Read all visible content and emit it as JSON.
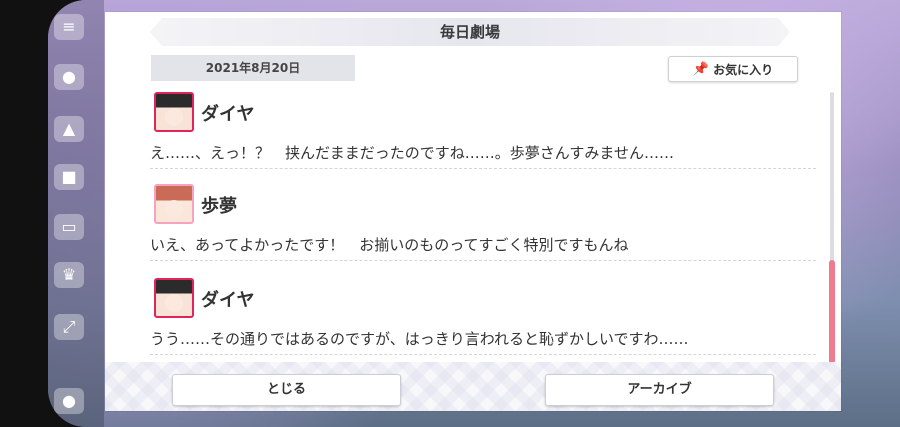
{
  "modal": {
    "title": "毎日劇場",
    "date": "2021年8月20日",
    "favorite_label": "お気に入り"
  },
  "messages": [
    {
      "speaker": "ダイヤ",
      "text": "え……、えっ！？　挟んだままだったのですね……。歩夢さんすみません……"
    },
    {
      "speaker": "歩夢",
      "text": "いえ、あってよかったです！　お揃いのものってすごく特別ですもんね"
    },
    {
      "speaker": "ダイヤ",
      "text": "うう……その通りではあるのですが、はっきり言われると恥ずかしいですわ……"
    }
  ],
  "footer": {
    "close_label": "とじる",
    "archive_label": "アーカイブ"
  },
  "colors": {
    "accent": "#f07a8e",
    "dia_frame": "#e0245e",
    "ayumu_frame": "#f5a3bf"
  },
  "icons": [
    "pin-icon",
    "menu-icon"
  ]
}
